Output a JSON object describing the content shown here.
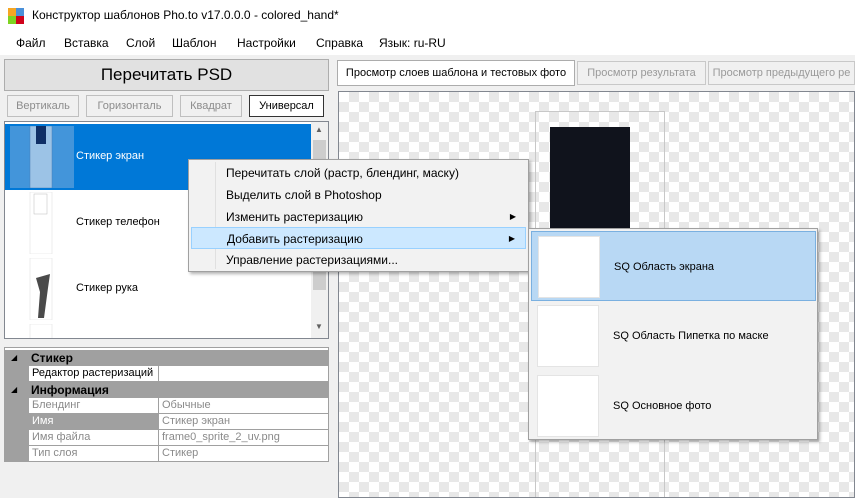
{
  "window": {
    "title": "Конструктор шаблонов Pho.to v17.0.0.0 - colored_hand*"
  },
  "menu": [
    {
      "label": "Файл"
    },
    {
      "label": "Вставка"
    },
    {
      "label": "Слой"
    },
    {
      "label": "Шаблон"
    },
    {
      "label": "Настройки"
    },
    {
      "label": "Справка"
    },
    {
      "label": "Язык: ru-RU"
    }
  ],
  "left_panel": {
    "reread_psd": "Перечитать PSD",
    "modes": [
      {
        "label": "Вертикаль"
      },
      {
        "label": "Горизонталь"
      },
      {
        "label": "Квадрат"
      },
      {
        "label": "Универсал"
      }
    ],
    "layers": [
      {
        "label": "Стикер экран"
      },
      {
        "label": "Стикер телефон"
      },
      {
        "label": "Стикер рука"
      }
    ]
  },
  "properties": {
    "cat_sticker": "Стикер",
    "raster_editor": "Редактор растеризаций",
    "cat_info": "Информация",
    "rows": [
      {
        "name": "Блендинг",
        "value": "Обычные"
      },
      {
        "name": "Имя",
        "value": "Стикер экран"
      },
      {
        "name": "Имя файла",
        "value": "frame0_sprite_2_uv.png"
      },
      {
        "name": "Тип слоя",
        "value": "Стикер"
      }
    ]
  },
  "tabs": [
    {
      "label": "Просмотр слоев шаблона и тестовых фото"
    },
    {
      "label": "Просмотр результата"
    },
    {
      "label": "Просмотр предыдущего ре"
    }
  ],
  "context_menu": [
    {
      "label": "Перечитать слой (растр, блендинг, маску)"
    },
    {
      "label": "Выделить слой в Photoshop"
    },
    {
      "label": "Изменить растеризацию"
    },
    {
      "label": "Добавить растеризацию"
    },
    {
      "label": "Управление растеризациями..."
    }
  ],
  "submenu": [
    {
      "label": "SQ Область экрана"
    },
    {
      "label": "SQ Область Пипетка по маске"
    },
    {
      "label": "SQ Основное фото"
    }
  ],
  "colors": {
    "selection": "#0078d7",
    "menu_highlight": "#cce8ff",
    "submenu_highlight": "#b8d8f4"
  }
}
